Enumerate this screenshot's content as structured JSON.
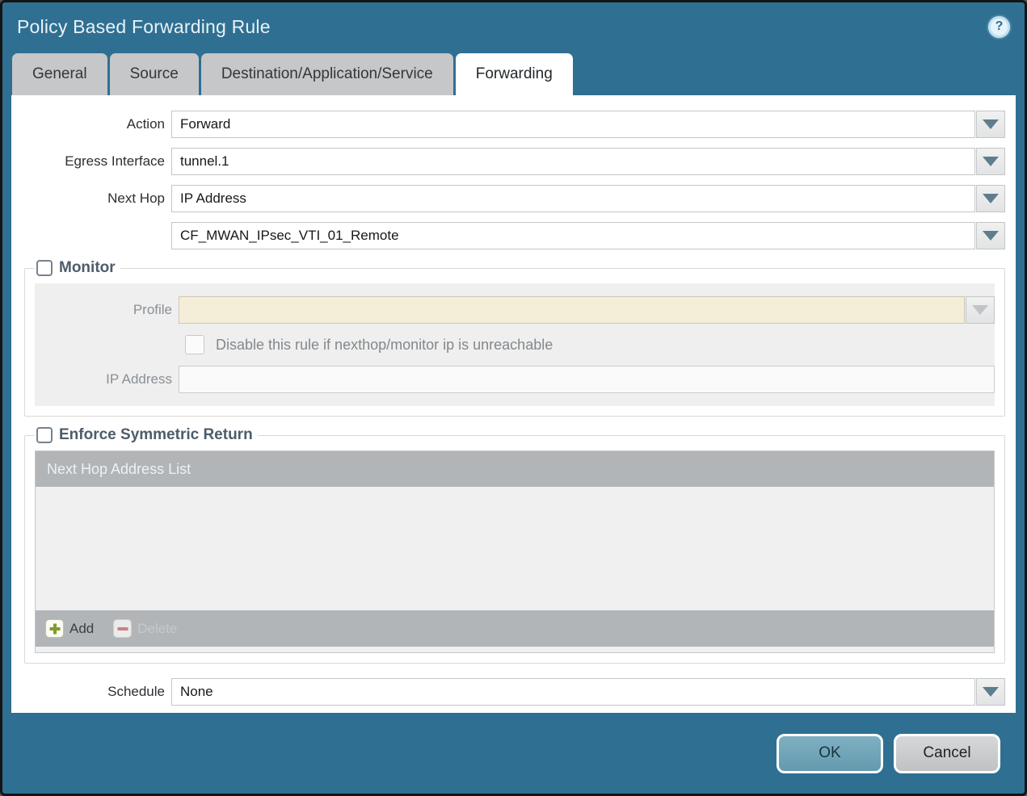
{
  "window": {
    "title": "Policy Based Forwarding Rule"
  },
  "tabs": [
    {
      "label": "General",
      "active": false
    },
    {
      "label": "Source",
      "active": false
    },
    {
      "label": "Destination/Application/Service",
      "active": false
    },
    {
      "label": "Forwarding",
      "active": true
    }
  ],
  "form": {
    "action": {
      "label": "Action",
      "value": "Forward"
    },
    "egress_interface": {
      "label": "Egress Interface",
      "value": "tunnel.1"
    },
    "next_hop": {
      "label": "Next Hop",
      "value": "IP Address"
    },
    "next_hop_address": {
      "value": "CF_MWAN_IPsec_VTI_01_Remote"
    },
    "schedule": {
      "label": "Schedule",
      "value": "None"
    }
  },
  "monitor": {
    "legend": "Monitor",
    "checked": false,
    "profile": {
      "label": "Profile",
      "value": ""
    },
    "disable_rule": {
      "label": "Disable this rule if nexthop/monitor ip is unreachable",
      "checked": false
    },
    "ip_address": {
      "label": "IP Address",
      "value": ""
    }
  },
  "enforce_symmetric_return": {
    "legend": "Enforce Symmetric Return",
    "checked": false,
    "table": {
      "header": "Next Hop Address List",
      "rows": []
    },
    "add_label": "Add",
    "delete_label": "Delete",
    "delete_enabled": false
  },
  "footer": {
    "ok_label": "OK",
    "cancel_label": "Cancel"
  },
  "icons": {
    "help": "help-icon",
    "dropdown": "chevron-down-icon",
    "add": "plus-icon",
    "delete": "minus-icon"
  },
  "colors": {
    "window_teal": "#2f6f92",
    "tab_inactive": "#c5c7c9",
    "panel_gray": "#efefef",
    "profile_disabled_beige": "#f4edd8",
    "table_bar_gray": "#b1b5b7",
    "ok_button": "#6fa3b8",
    "add_green": "#7f9c2e",
    "delete_red": "#c98184"
  },
  "help_glyph": "?"
}
